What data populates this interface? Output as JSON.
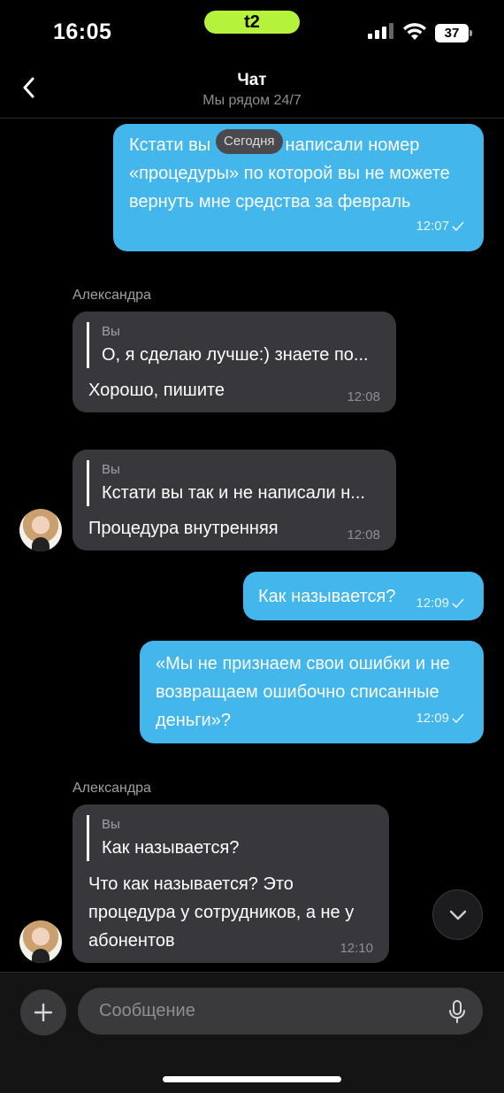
{
  "status_bar": {
    "time": "16:05",
    "carrier": "t2",
    "battery": "37"
  },
  "header": {
    "title": "Чат",
    "subtitle": "Мы рядом 24/7"
  },
  "date_divider": "Сегодня",
  "messages": [
    {
      "direction": "out",
      "lines": [
        "Кстати вы так и не написали номер",
        "«процедуры» по которой вы не можете",
        "вернуть мне средства за февраль"
      ],
      "time": "12:07"
    },
    {
      "direction": "in",
      "sender": "Александра",
      "quote_author": "Вы",
      "quote_text": "О, я сделаю лучше:) знаете по...",
      "lines": [
        "Хорошо, пишите"
      ],
      "time": "12:08"
    },
    {
      "direction": "in",
      "quote_author": "Вы",
      "quote_text": "Кстати вы так и не написали н...",
      "lines": [
        "Процедура внутренняя"
      ],
      "time": "12:08"
    },
    {
      "direction": "out",
      "lines": [
        "Как называется?"
      ],
      "time": "12:09"
    },
    {
      "direction": "out",
      "lines": [
        "«Мы не признаем свои ошибки и не",
        "возвращаем ошибочно списанные",
        "деньги»?"
      ],
      "time": "12:09"
    },
    {
      "direction": "in",
      "sender": "Александра",
      "quote_author": "Вы",
      "quote_text": "Как называется?",
      "lines": [
        "Что как называется? Это",
        "процедура у сотрудников, а не у",
        "абонентов"
      ],
      "time": "12:10"
    }
  ],
  "composer": {
    "placeholder": "Сообщение"
  },
  "colors": {
    "outgoing_bubble": "#43b6ec",
    "incoming_bubble": "#38383c",
    "carrier_accent": "#b5f23b",
    "background": "#000000"
  }
}
